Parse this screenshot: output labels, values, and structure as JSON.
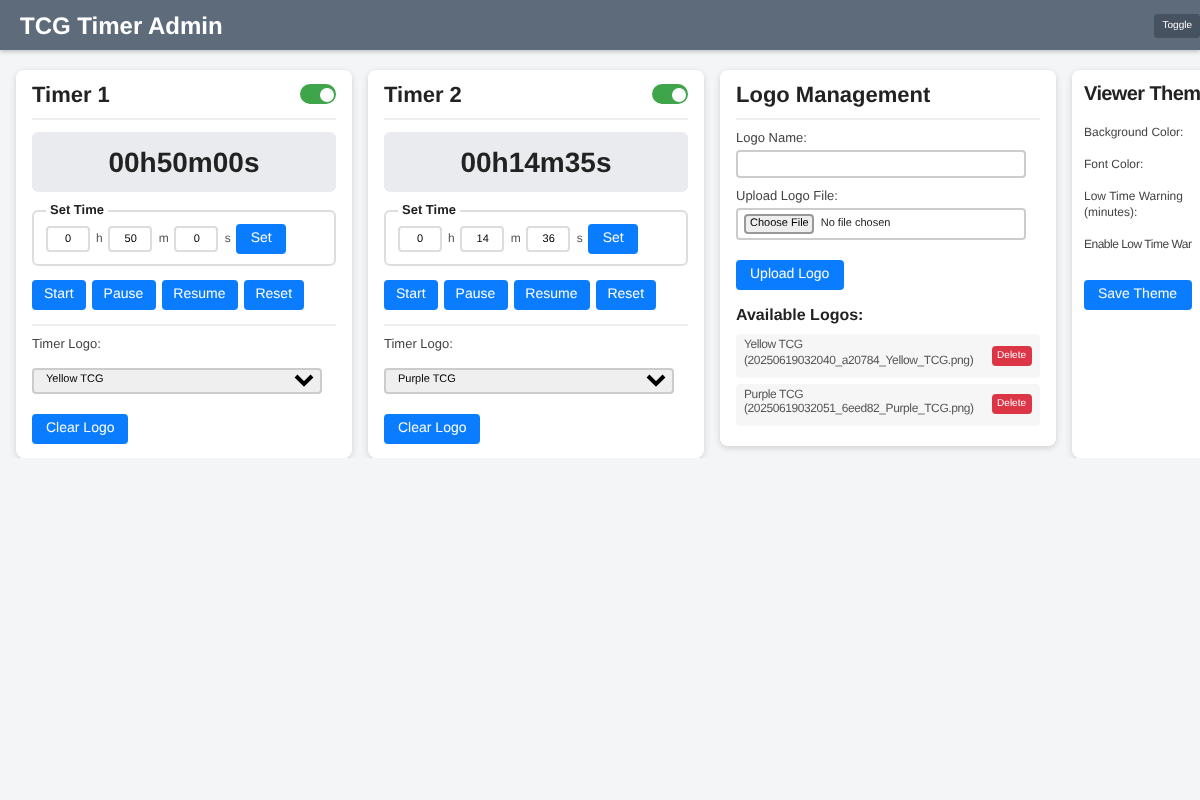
{
  "header": {
    "title": "TCG Timer Admin",
    "toggle_button": "Toggle"
  },
  "timers": [
    {
      "title": "Timer 1",
      "enabled": true,
      "display": "00h50m00s",
      "set_time": {
        "legend": "Set Time",
        "hours": "0",
        "hours_unit": "h",
        "minutes": "50",
        "minutes_unit": "m",
        "seconds": "0",
        "seconds_unit": "s",
        "set_button": "Set"
      },
      "buttons": [
        "Start",
        "Pause",
        "Resume",
        "Reset"
      ],
      "logo_label": "Timer Logo:",
      "logo_value": "Yellow TCG",
      "clear_button": "Clear Logo"
    },
    {
      "title": "Timer 2",
      "enabled": true,
      "display": "00h14m35s",
      "set_time": {
        "legend": "Set Time",
        "hours": "0",
        "hours_unit": "h",
        "minutes": "14",
        "minutes_unit": "m",
        "seconds": "36",
        "seconds_unit": "s",
        "set_button": "Set"
      },
      "buttons": [
        "Start",
        "Pause",
        "Resume",
        "Reset"
      ],
      "logo_label": "Timer Logo:",
      "logo_value": "Purple TCG",
      "clear_button": "Clear Logo"
    }
  ],
  "logo_management": {
    "title": "Logo Management",
    "name_label": "Logo Name:",
    "file_label": "Upload Logo File:",
    "choose_button": "Choose File",
    "file_status": "No file chosen",
    "upload_button": "Upload Logo",
    "available_title": "Available Logos:",
    "logos": [
      {
        "name": "Yellow TCG",
        "file": "(20250619032040_a20784_Yellow_TCG.png)",
        "delete_button": "Delete"
      },
      {
        "name": "Purple TCG",
        "file": "(20250619032051_6eed82_Purple_TCG.png)",
        "delete_button": "Delete"
      }
    ]
  },
  "viewer_theme": {
    "title": "Viewer Them",
    "labels": [
      "Background Color:",
      "Font Color:",
      "Low Time Warning (minutes):",
      "Enable Low Time War"
    ],
    "save_button": "Save Theme"
  }
}
